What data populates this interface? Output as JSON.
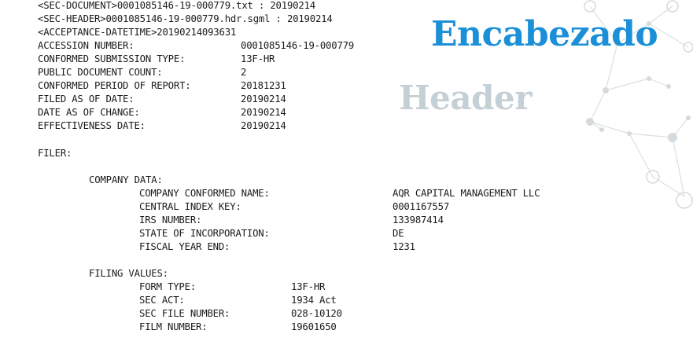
{
  "titles": {
    "spanish": "Encabezado",
    "english": "Header"
  },
  "header_lines": [
    "<SEC-DOCUMENT>0001085146-19-000779.txt : 20190214",
    "<SEC-HEADER>0001085146-19-000779.hdr.sgml : 20190214",
    "<ACCEPTANCE-DATETIME>20190214093631"
  ],
  "summary": [
    {
      "label": "ACCESSION NUMBER:",
      "value": "0001085146-19-000779"
    },
    {
      "label": "CONFORMED SUBMISSION TYPE:",
      "value": "13F-HR"
    },
    {
      "label": "PUBLIC DOCUMENT COUNT:",
      "value": "2"
    },
    {
      "label": "CONFORMED PERIOD OF REPORT:",
      "value": "20181231"
    },
    {
      "label": "FILED AS OF DATE:",
      "value": "20190214"
    },
    {
      "label": "DATE AS OF CHANGE:",
      "value": "20190214"
    },
    {
      "label": "EFFECTIVENESS DATE:",
      "value": "20190214"
    }
  ],
  "filer_label": "FILER:",
  "company_data_label": "COMPANY DATA:",
  "company_data": [
    {
      "label": "COMPANY CONFORMED NAME:",
      "value": "AQR CAPITAL MANAGEMENT LLC"
    },
    {
      "label": "CENTRAL INDEX KEY:",
      "value": "0001167557"
    },
    {
      "label": "IRS NUMBER:",
      "value": "133987414"
    },
    {
      "label": "STATE OF INCORPORATION:",
      "value": "DE"
    },
    {
      "label": "FISCAL YEAR END:",
      "value": "1231"
    }
  ],
  "filing_values_label": "FILING VALUES:",
  "filing_values": [
    {
      "label": "FORM TYPE:",
      "value": "13F-HR"
    },
    {
      "label": "SEC ACT:",
      "value": "1934 Act"
    },
    {
      "label": "SEC FILE NUMBER:",
      "value": "028-10120"
    },
    {
      "label": "FILM NUMBER:",
      "value": "19601650"
    }
  ],
  "colors": {
    "title_blue": "#1b8fd8",
    "title_gray": "#c5cfd6",
    "network": "#d4dadd"
  }
}
